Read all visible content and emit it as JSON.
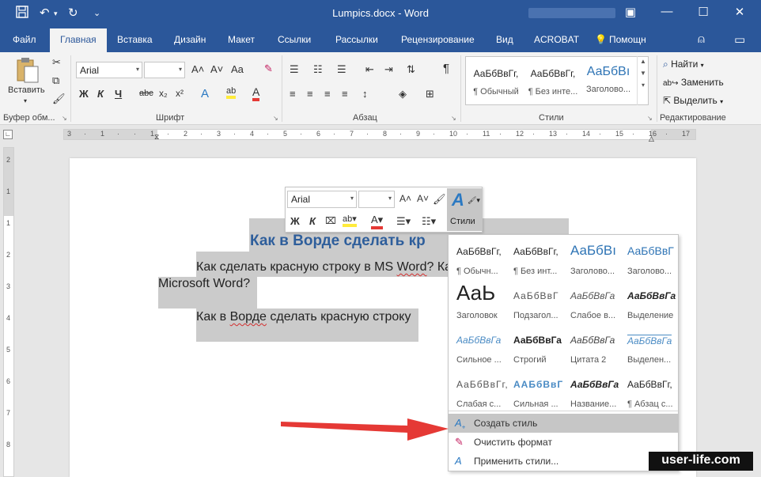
{
  "window": {
    "title": "Lumpics.docx - Word",
    "quick_access": {
      "save_icon": "save-icon",
      "undo_icon": "undo-icon",
      "redo_icon": "redo-icon",
      "customize_icon": "customize-icon"
    },
    "controls": {
      "ribbon_options": "▣",
      "minimize": "—",
      "maximize": "☐",
      "close": "✕"
    }
  },
  "tabs": [
    {
      "label": "Файл"
    },
    {
      "label": "Главная"
    },
    {
      "label": "Вставка"
    },
    {
      "label": "Дизайн"
    },
    {
      "label": "Макет"
    },
    {
      "label": "Ссылки"
    },
    {
      "label": "Рассылки"
    },
    {
      "label": "Рецензирование"
    },
    {
      "label": "Вид"
    },
    {
      "label": "ACROBAT"
    },
    {
      "label": "Помощн"
    }
  ],
  "tab_icons": {
    "help": "💡",
    "share": "⍝",
    "comments": "▭"
  },
  "ribbon": {
    "clipboard": {
      "paste_label": "Вставить",
      "group_label": "Буфер обм..."
    },
    "font": {
      "name": "Arial",
      "size": "",
      "grow": "A˄",
      "shrink": "A˅",
      "case": "Aa",
      "clear": "✎",
      "bold": "Ж",
      "italic": "К",
      "underline": "Ч",
      "strike": "abc",
      "sub": "x₂",
      "sup": "x²",
      "effects": "A",
      "highlight": "ab",
      "color": "A",
      "group_label": "Шрифт"
    },
    "paragraph": {
      "group_label": "Абзац",
      "pilcrow": "¶"
    },
    "styles": {
      "items": [
        {
          "sample": "АаБбВвГг,",
          "name": "¶ Обычный"
        },
        {
          "sample": "АаБбВвГг,",
          "name": "¶ Без инте..."
        },
        {
          "sample": "АаБбВı",
          "name": "Заголово..."
        }
      ],
      "group_label": "Стили"
    },
    "editing": {
      "find": "Найти",
      "replace": "Заменить",
      "select": "Выделить",
      "group_label": "Редактирование"
    }
  },
  "ruler": {
    "ticks": [
      "3",
      "·",
      "1",
      "·",
      "·",
      "1",
      "·",
      "2",
      "·",
      "3",
      "·",
      "4",
      "·",
      "5",
      "·",
      "6",
      "·",
      "7",
      "·",
      "8",
      "·",
      "9",
      "·",
      "10",
      "·",
      "11",
      "·",
      "12",
      "·",
      "13",
      "·",
      "14",
      "·",
      "15",
      "·",
      "16",
      "·",
      "17"
    ],
    "vticks": [
      "2",
      "1",
      "1",
      "2",
      "3",
      "4",
      "5",
      "6",
      "7",
      "8"
    ]
  },
  "document": {
    "heading": "Как в Ворде сделать кр",
    "para1_a": "Как сделать красную строку в MS ",
    "para1_b": "Word",
    "para1_c": "? Ка",
    "para1_line2": "Microsoft Word?",
    "para2_a": "Как в ",
    "para2_b": "Ворде",
    "para2_c": " сделать красную строку"
  },
  "mini_toolbar": {
    "font": "Arial",
    "size": "",
    "grow": "A˄",
    "shrink": "A˅",
    "bold": "Ж",
    "italic": "К",
    "styles_label": "Стили"
  },
  "styles_dropdown": {
    "cells": [
      {
        "sample": "АаБбВвГг,",
        "name": "¶ Обычн..."
      },
      {
        "sample": "АаБбВвГг,",
        "name": "¶ Без инт..."
      },
      {
        "sample": "АаБбВı",
        "name": "Заголово..."
      },
      {
        "sample": "АаБбВвГ",
        "name": "Заголово..."
      },
      {
        "sample": "АаЬ",
        "name": "Заголовок"
      },
      {
        "sample": "АаБбВвГ",
        "name": "Подзагол..."
      },
      {
        "sample": "АаБбВвГа",
        "name": "Слабое в..."
      },
      {
        "sample": "АаБбВвГа",
        "name": "Выделение"
      },
      {
        "sample": "АаБбВвГа",
        "name": "Сильное ..."
      },
      {
        "sample": "АаБбВвГа",
        "name": "Строгий"
      },
      {
        "sample": "АаБбВвГа",
        "name": "Цитата 2"
      },
      {
        "sample": "АаБбВвГа",
        "name": "Выделен..."
      },
      {
        "sample": "АаБбВвГг,",
        "name": "Слабая с..."
      },
      {
        "sample": "ААБбВвГг",
        "name": "Сильная ..."
      },
      {
        "sample": "АаБбВвГа",
        "name": "Название..."
      },
      {
        "sample": "АаБбВвГг,",
        "name": "¶ Абзац с..."
      }
    ],
    "actions": [
      {
        "label": "Создать стиль",
        "icon": "create-style-icon"
      },
      {
        "label": "Очистить формат",
        "icon": "clear-format-icon"
      },
      {
        "label": "Применить стили...",
        "icon": "apply-styles-icon"
      }
    ]
  },
  "watermark": "user-life.com",
  "colors": {
    "accent": "#2b579a",
    "heading": "#2e5e9b",
    "arrow": "#e53935",
    "selection": "#cbcbcb"
  }
}
